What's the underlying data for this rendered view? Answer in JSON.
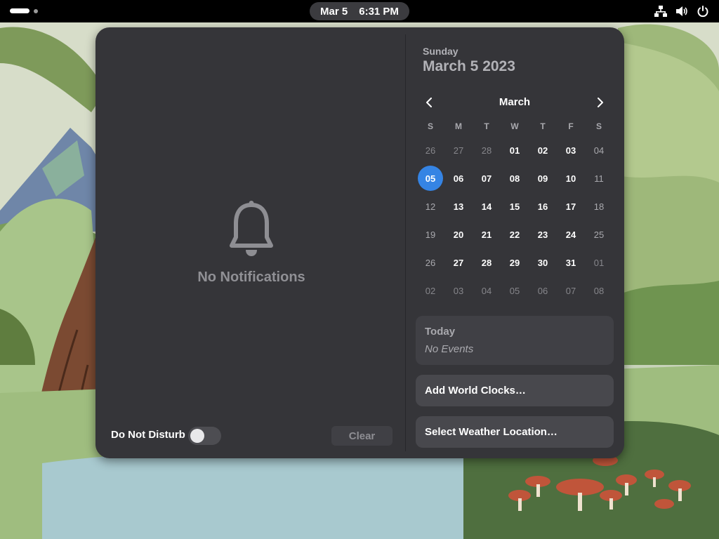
{
  "topbar": {
    "clock_date": "Mar 5",
    "clock_time": "6:31 PM",
    "tray_icons": [
      "network-wired-icon",
      "volume-icon",
      "power-icon"
    ]
  },
  "notifications": {
    "empty_label": "No Notifications",
    "dnd_label": "Do Not Disturb",
    "dnd_enabled": false,
    "clear_label": "Clear"
  },
  "calendar": {
    "day_name": "Sunday",
    "full_date": "March 5 2023",
    "month_label": "March",
    "weekdays": [
      "S",
      "M",
      "T",
      "W",
      "T",
      "F",
      "S"
    ],
    "days": [
      "26",
      "27",
      "28",
      "01",
      "02",
      "03",
      "04",
      "05",
      "06",
      "07",
      "08",
      "09",
      "10",
      "11",
      "12",
      "13",
      "14",
      "15",
      "16",
      "17",
      "18",
      "19",
      "20",
      "21",
      "22",
      "23",
      "24",
      "25",
      "26",
      "27",
      "28",
      "29",
      "30",
      "31",
      "01",
      "02",
      "03",
      "04",
      "05",
      "06",
      "07",
      "08"
    ],
    "selected_index": 7,
    "current_month_range": [
      3,
      33
    ]
  },
  "events": {
    "title": "Today",
    "empty": "No Events"
  },
  "actions": {
    "world_clocks": "Add World Clocks…",
    "weather": "Select Weather Location…"
  },
  "colors": {
    "accent": "#3584e4",
    "popover_bg": "#353539",
    "card_bg": "#404045"
  }
}
